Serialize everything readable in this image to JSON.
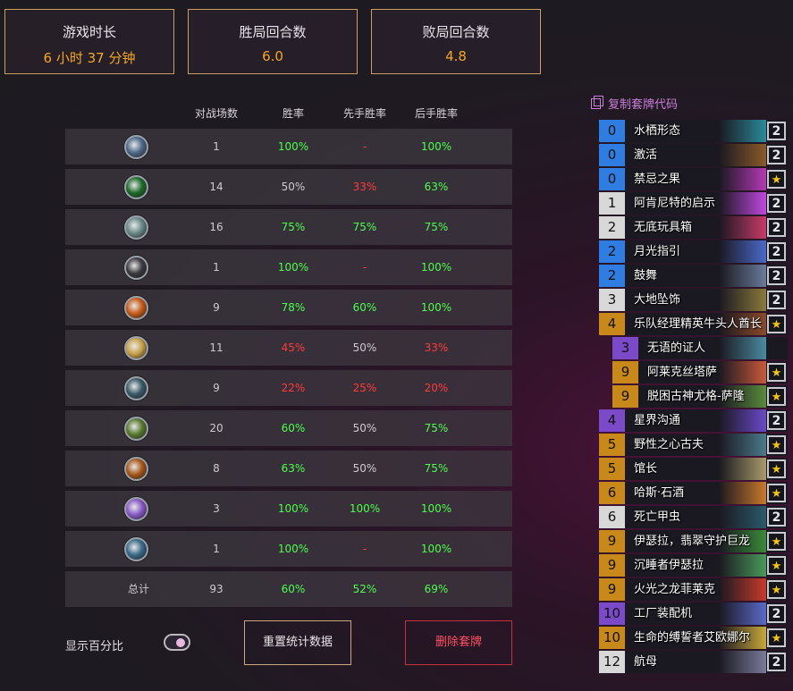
{
  "stats": [
    {
      "label": "游戏时长",
      "value": "6 小时 37 分钟"
    },
    {
      "label": "胜局回合数",
      "value": "6.0"
    },
    {
      "label": "败局回合数",
      "value": "4.8"
    }
  ],
  "table": {
    "headers": [
      "对战场数",
      "胜率",
      "先手胜率",
      "后手胜率"
    ],
    "rows": [
      {
        "icon": "rogue-class-icon",
        "color": "#4d6a8a",
        "games": "1",
        "winrate": "100%",
        "first": "-",
        "second": "100%",
        "c": [
          "g",
          "r",
          "g"
        ]
      },
      {
        "icon": "hunter-class-icon",
        "color": "#1e6b2a",
        "games": "14",
        "winrate": "50%",
        "first": "33%",
        "second": "63%",
        "c": [
          "n",
          "r",
          "g"
        ]
      },
      {
        "icon": "druid-class-icon",
        "color": "#6a8a8a",
        "games": "16",
        "winrate": "75%",
        "first": "75%",
        "second": "75%",
        "c": [
          "g",
          "g",
          "g"
        ]
      },
      {
        "icon": "warrior-class-icon",
        "color": "#3a3a40",
        "games": "1",
        "winrate": "100%",
        "first": "-",
        "second": "100%",
        "c": [
          "g",
          "r",
          "g"
        ]
      },
      {
        "icon": "mage-class-icon",
        "color": "#c85a18",
        "games": "9",
        "winrate": "78%",
        "first": "60%",
        "second": "100%",
        "c": [
          "g",
          "g",
          "g"
        ]
      },
      {
        "icon": "paladin-class-icon",
        "color": "#c8a048",
        "games": "11",
        "winrate": "45%",
        "first": "50%",
        "second": "33%",
        "c": [
          "r",
          "n",
          "r"
        ]
      },
      {
        "icon": "shaman-class-icon",
        "color": "#3a5a6a",
        "games": "9",
        "winrate": "22%",
        "first": "25%",
        "second": "20%",
        "c": [
          "r",
          "r",
          "r"
        ]
      },
      {
        "icon": "demon-hunter-class-icon",
        "color": "#5a7a30",
        "games": "20",
        "winrate": "60%",
        "first": "50%",
        "second": "75%",
        "c": [
          "g",
          "n",
          "g"
        ]
      },
      {
        "icon": "warlock-class-icon",
        "color": "#a8581a",
        "games": "8",
        "winrate": "63%",
        "first": "50%",
        "second": "75%",
        "c": [
          "g",
          "n",
          "g"
        ]
      },
      {
        "icon": "priest-class-icon",
        "color": "#8a5ac8",
        "games": "3",
        "winrate": "100%",
        "first": "100%",
        "second": "100%",
        "c": [
          "g",
          "g",
          "g"
        ]
      },
      {
        "icon": "death-knight-class-icon",
        "color": "#3a6a8a",
        "games": "1",
        "winrate": "100%",
        "first": "-",
        "second": "100%",
        "c": [
          "g",
          "r",
          "g"
        ]
      }
    ],
    "total": {
      "label": "总计",
      "games": "93",
      "winrate": "60%",
      "first": "52%",
      "second": "69%"
    }
  },
  "controls": {
    "show_percent_label": "显示百分比",
    "reset_label": "重置统计数据",
    "delete_label": "删除套牌"
  },
  "deck": {
    "copy_label": "复制套牌代码",
    "cards": [
      {
        "cost": "0",
        "name": "水栖形态",
        "qty": "2",
        "costbg": "#2f7de0",
        "art": "#2a8a9a",
        "sub": false
      },
      {
        "cost": "0",
        "name": "激活",
        "qty": "2",
        "costbg": "#2f7de0",
        "art": "#8a5a2a",
        "sub": false
      },
      {
        "cost": "0",
        "name": "禁忌之果",
        "qty": "★",
        "costbg": "#2f7de0",
        "art": "#b43ab4",
        "sub": false
      },
      {
        "cost": "1",
        "name": "阿肯尼特的启示",
        "qty": "2",
        "costbg": "#d8d8d8",
        "art": "#c048e0",
        "sub": false
      },
      {
        "cost": "2",
        "name": "无底玩具箱",
        "qty": "2",
        "costbg": "#d8d8d8",
        "art": "#c83a6a",
        "sub": false
      },
      {
        "cost": "2",
        "name": "月光指引",
        "qty": "2",
        "costbg": "#2f7de0",
        "art": "#4a6ac8",
        "sub": false
      },
      {
        "cost": "2",
        "name": "鼓舞",
        "qty": "2",
        "costbg": "#2f7de0",
        "art": "#6a7a9a",
        "sub": false
      },
      {
        "cost": "3",
        "name": "大地坠饰",
        "qty": "2",
        "costbg": "#d8d8d8",
        "art": "#8a7a3a",
        "sub": false
      },
      {
        "cost": "4",
        "name": "乐队经理精英牛头人酋长",
        "qty": "★",
        "costbg": "#c8881a",
        "art": "#8a4a2a",
        "sub": false
      },
      {
        "cost": "3",
        "name": "无语的证人",
        "qty": "",
        "costbg": "#7a4ac8",
        "art": "#4a8aa0",
        "sub": true
      },
      {
        "cost": "9",
        "name": "阿莱克丝塔萨",
        "qty": "★",
        "costbg": "#c8881a",
        "art": "#c85a3a",
        "sub": true
      },
      {
        "cost": "9",
        "name": "脱困古神尤格-萨隆",
        "qty": "★",
        "costbg": "#c8881a",
        "art": "#5a8a3a",
        "sub": true
      },
      {
        "cost": "4",
        "name": "星界沟通",
        "qty": "2",
        "costbg": "#7a4ac8",
        "art": "#6a4ac8",
        "sub": false
      },
      {
        "cost": "5",
        "name": "野性之心古夫",
        "qty": "★",
        "costbg": "#c8881a",
        "art": "#4a7a8a",
        "sub": false
      },
      {
        "cost": "5",
        "name": "馆长",
        "qty": "★",
        "costbg": "#c8881a",
        "art": "#a89a6a",
        "sub": false
      },
      {
        "cost": "6",
        "name": "哈斯·石酒",
        "qty": "★",
        "costbg": "#c8881a",
        "art": "#c8782a",
        "sub": false
      },
      {
        "cost": "6",
        "name": "死亡甲虫",
        "qty": "2",
        "costbg": "#d8d8d8",
        "art": "#2a5a6a",
        "sub": false
      },
      {
        "cost": "9",
        "name": "伊瑟拉，翡翠守护巨龙",
        "qty": "★",
        "costbg": "#c8881a",
        "art": "#3a8a3a",
        "sub": false
      },
      {
        "cost": "9",
        "name": "沉睡者伊瑟拉",
        "qty": "★",
        "costbg": "#c8881a",
        "art": "#4a9a5a",
        "sub": false
      },
      {
        "cost": "9",
        "name": "火光之龙菲莱克",
        "qty": "★",
        "costbg": "#c8881a",
        "art": "#c83a2a",
        "sub": false
      },
      {
        "cost": "10",
        "name": "工厂装配机",
        "qty": "2",
        "costbg": "#7a4ac8",
        "art": "#5a6ac8",
        "sub": false
      },
      {
        "cost": "10",
        "name": "生命的缚誓者艾欧娜尔",
        "qty": "★",
        "costbg": "#c8881a",
        "art": "#c8a83a",
        "sub": false
      },
      {
        "cost": "12",
        "name": "航母",
        "qty": "2",
        "costbg": "#d8d8d8",
        "art": "#7a7a9a",
        "sub": false
      }
    ]
  }
}
